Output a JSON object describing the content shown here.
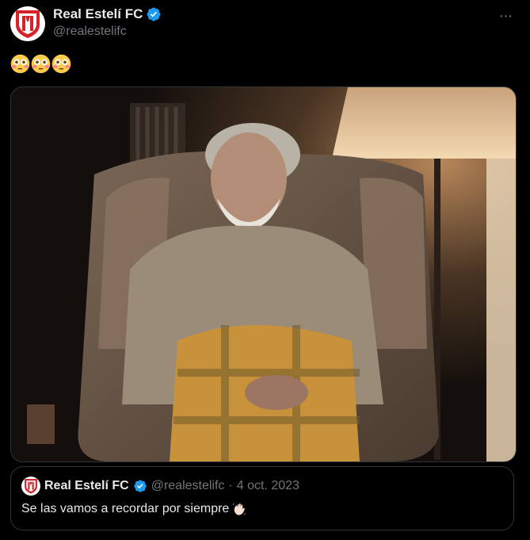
{
  "tweet": {
    "author": {
      "display_name": "Real Estelí FC",
      "handle": "@realestelifc"
    },
    "more_label": "···",
    "text_emoji": [
      "flushed-face",
      "flushed-face",
      "flushed-face"
    ]
  },
  "quoted_tweet": {
    "author": {
      "display_name": "Real Estelí FC",
      "handle": "@realestelifc"
    },
    "separator": "·",
    "date": "4 oct. 2023",
    "text": "Se las vamos a recordar por siempre",
    "emoji": "waving-hand"
  },
  "colors": {
    "background": "#000000",
    "text_primary": "#e7e9ea",
    "text_secondary": "#71767b",
    "border": "#2f3336",
    "verified_badge": "#1d9bf0",
    "brand_red": "#d6232a"
  }
}
